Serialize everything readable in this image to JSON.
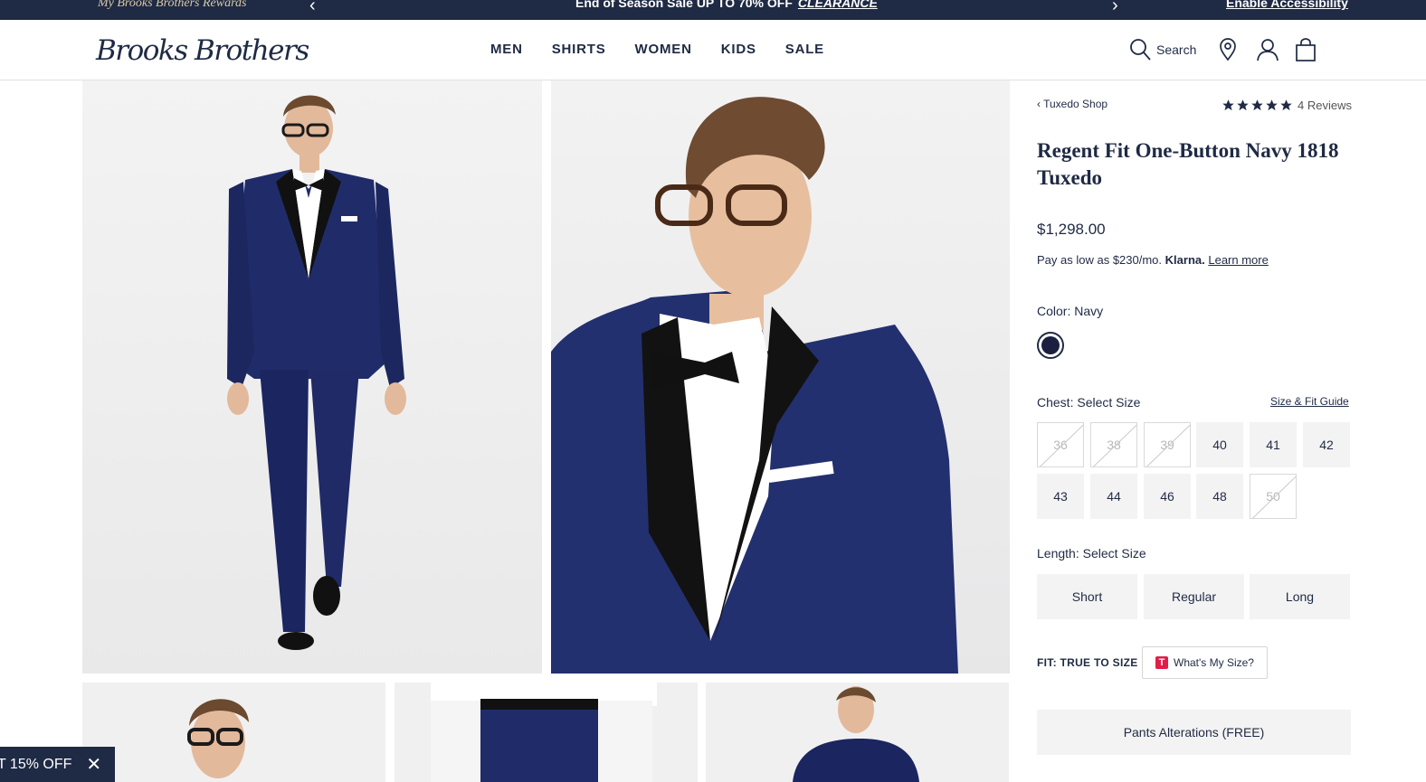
{
  "promo": {
    "rewards": "My Brooks Brothers Rewards",
    "message": "End of Season Sale UP TO 70% OFF",
    "link": "CLEARANCE",
    "accessibility": "Enable Accessibility",
    "prev_icon": "chevron-left-icon",
    "next_icon": "chevron-right-icon"
  },
  "header": {
    "logo": "Brooks Brothers",
    "nav": [
      "MEN",
      "SHIRTS",
      "WOMEN",
      "KIDS",
      "SALE"
    ],
    "search_label": "Search",
    "icons": [
      "search-icon",
      "location-pin-icon",
      "account-icon",
      "shopping-bag-icon"
    ]
  },
  "product": {
    "breadcrumb": "‹ Tuxedo Shop",
    "rating": 5,
    "reviews": "4 Reviews",
    "title": "Regent Fit One-Button Navy 1818 Tuxedo",
    "price": "$1,298.00",
    "klarna": {
      "prefix": "Pay as low as $230/mo.",
      "brand": "Klarna.",
      "link": "Learn more"
    },
    "color": {
      "label": "Color:",
      "value": "Navy",
      "swatch": "#1b2040"
    },
    "chest": {
      "label": "Chest:",
      "value": "Select Size",
      "guide": "Size & Fit Guide",
      "sizes": [
        {
          "v": "36",
          "available": false
        },
        {
          "v": "38",
          "available": false
        },
        {
          "v": "39",
          "available": false
        },
        {
          "v": "40",
          "available": true
        },
        {
          "v": "41",
          "available": true
        },
        {
          "v": "42",
          "available": true
        },
        {
          "v": "43",
          "available": true
        },
        {
          "v": "44",
          "available": true
        },
        {
          "v": "46",
          "available": true
        },
        {
          "v": "48",
          "available": true
        },
        {
          "v": "50",
          "available": false
        }
      ]
    },
    "length": {
      "label": "Length:",
      "value": "Select Size",
      "options": [
        "Short",
        "Regular",
        "Long"
      ]
    },
    "fit": "FIT: TRUE TO SIZE",
    "whats_my_size": "What's My Size?",
    "whats_my_size_badge": "T",
    "alterations": "Pants Alterations (FREE)"
  },
  "offer": {
    "text": "T 15% OFF",
    "close_icon": "close-icon"
  }
}
